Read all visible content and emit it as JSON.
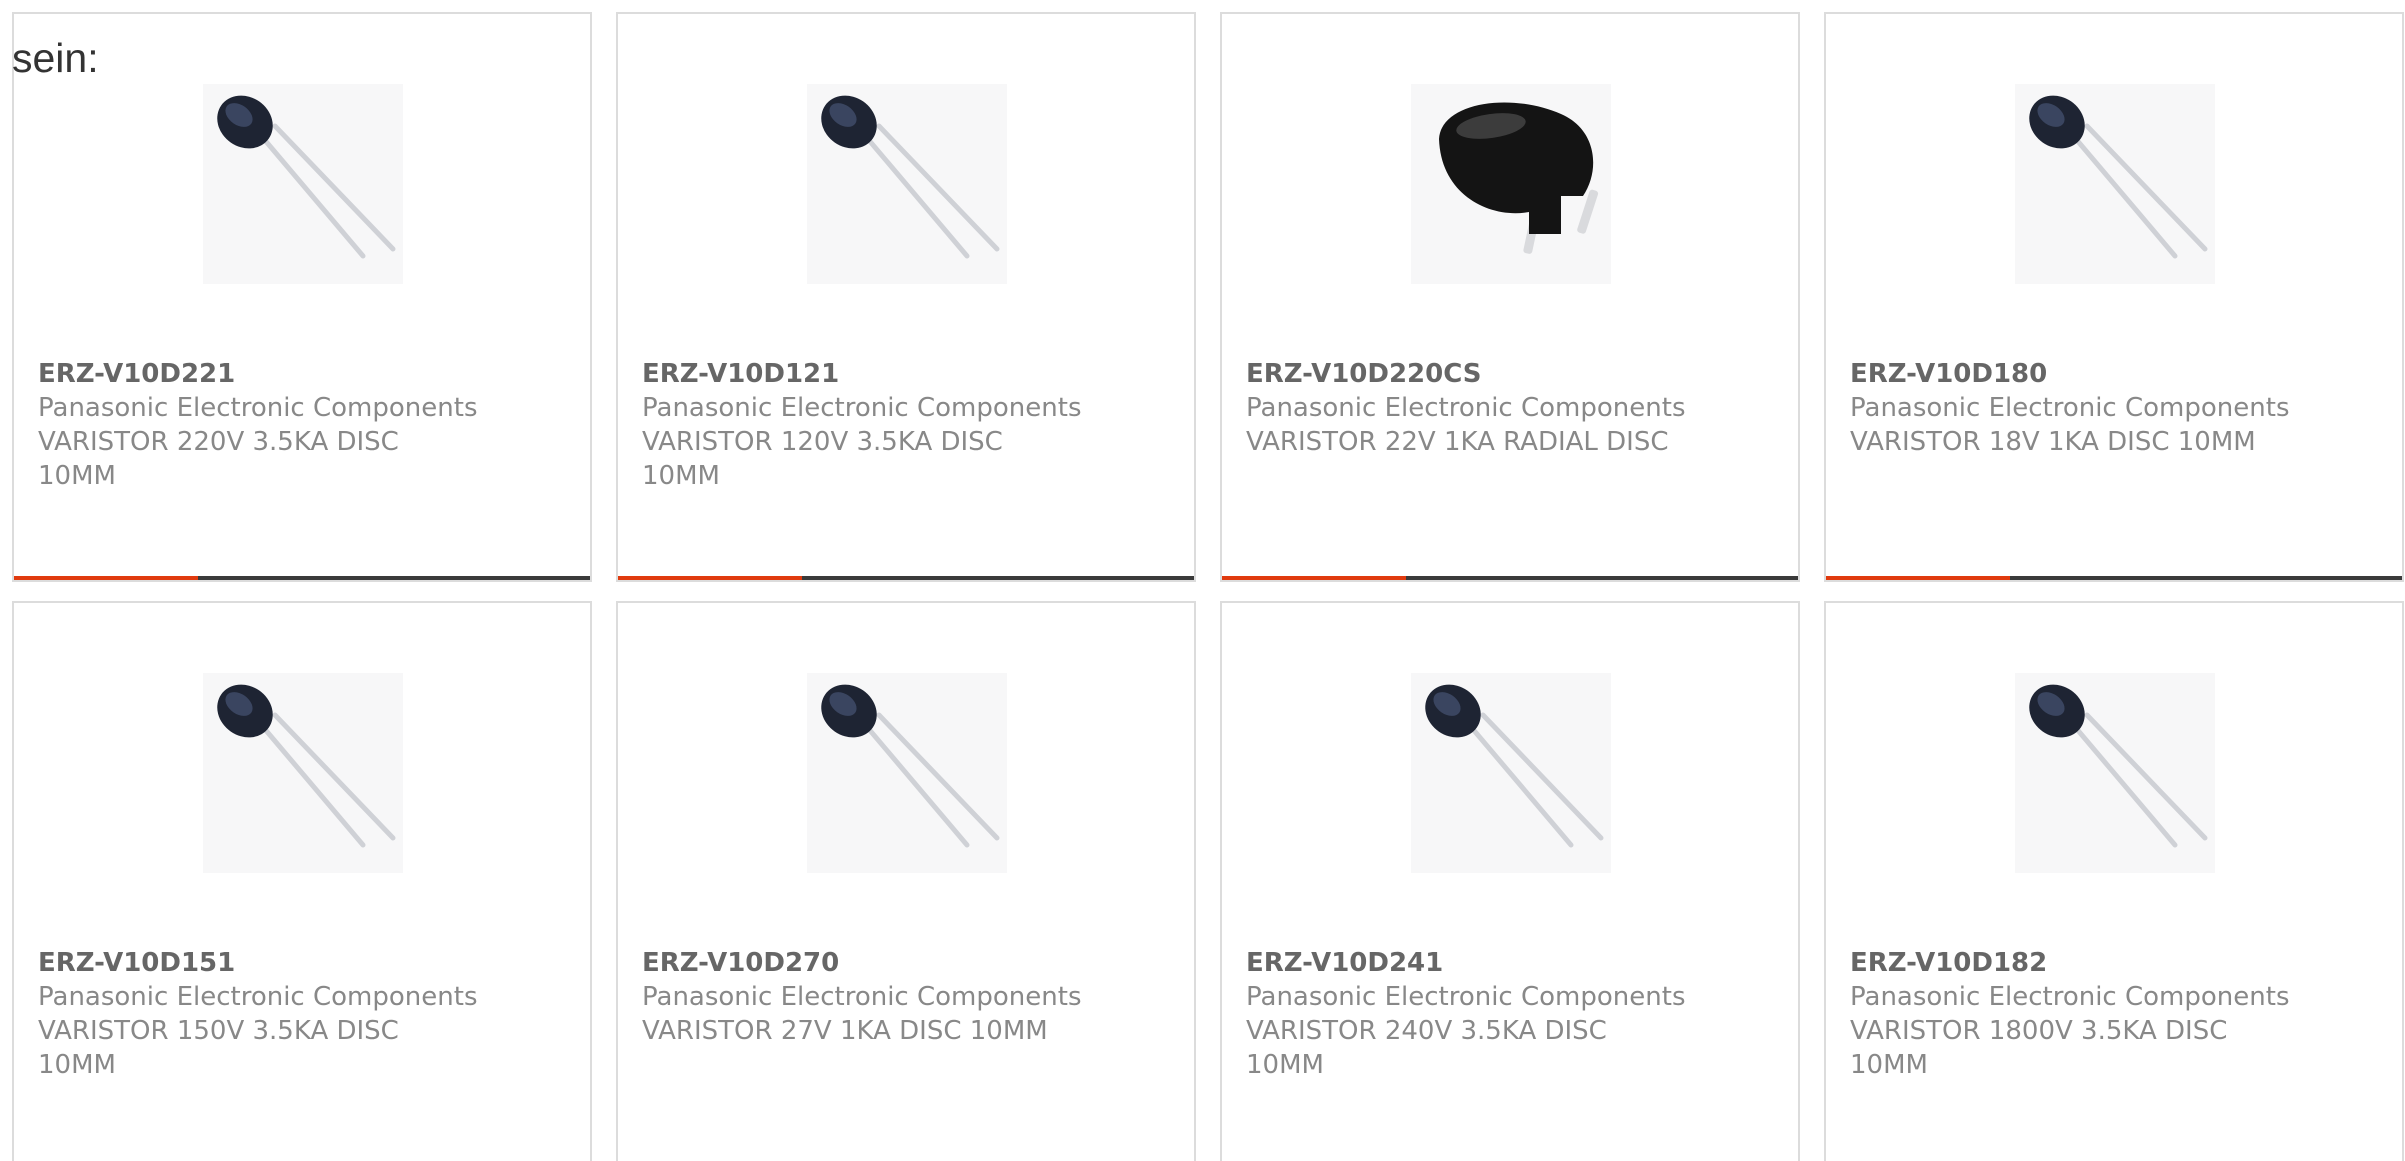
{
  "intro_text": "sein:",
  "accent_color": "#e03a0e",
  "products": [
    {
      "part": "ERZ-V10D221",
      "maker": "Panasonic Electronic Components",
      "description": "VARISTOR 220V 3.5KA DISC 10MM",
      "image": "radial-varistor-icon",
      "progress": 0.32
    },
    {
      "part": "ERZ-V10D121",
      "maker": "Panasonic Electronic Components",
      "description": "VARISTOR 120V 3.5KA DISC 10MM",
      "image": "radial-varistor-icon",
      "progress": 0.32
    },
    {
      "part": "ERZ-V10D220CS",
      "maker": "Panasonic Electronic Components",
      "description": "VARISTOR 22V 1KA RADIAL DISC",
      "image": "black-disc-varistor-icon",
      "progress": 0.32
    },
    {
      "part": "ERZ-V10D180",
      "maker": "Panasonic Electronic Components",
      "description": "VARISTOR 18V 1KA DISC 10MM",
      "image": "radial-varistor-icon",
      "progress": 0.32
    },
    {
      "part": "ERZ-V10D151",
      "maker": "Panasonic Electronic Components",
      "description": "VARISTOR 150V 3.5KA DISC 10MM",
      "image": "radial-varistor-icon"
    },
    {
      "part": "ERZ-V10D270",
      "maker": "Panasonic Electronic Components",
      "description": "VARISTOR 27V 1KA DISC 10MM",
      "image": "radial-varistor-icon"
    },
    {
      "part": "ERZ-V10D241",
      "maker": "Panasonic Electronic Components",
      "description": "VARISTOR 240V 3.5KA DISC 10MM",
      "image": "radial-varistor-icon"
    },
    {
      "part": "ERZ-V10D182",
      "maker": "Panasonic Electronic Components",
      "description": "VARISTOR 1800V 3.5KA DISC 10MM",
      "image": "radial-varistor-icon"
    }
  ]
}
